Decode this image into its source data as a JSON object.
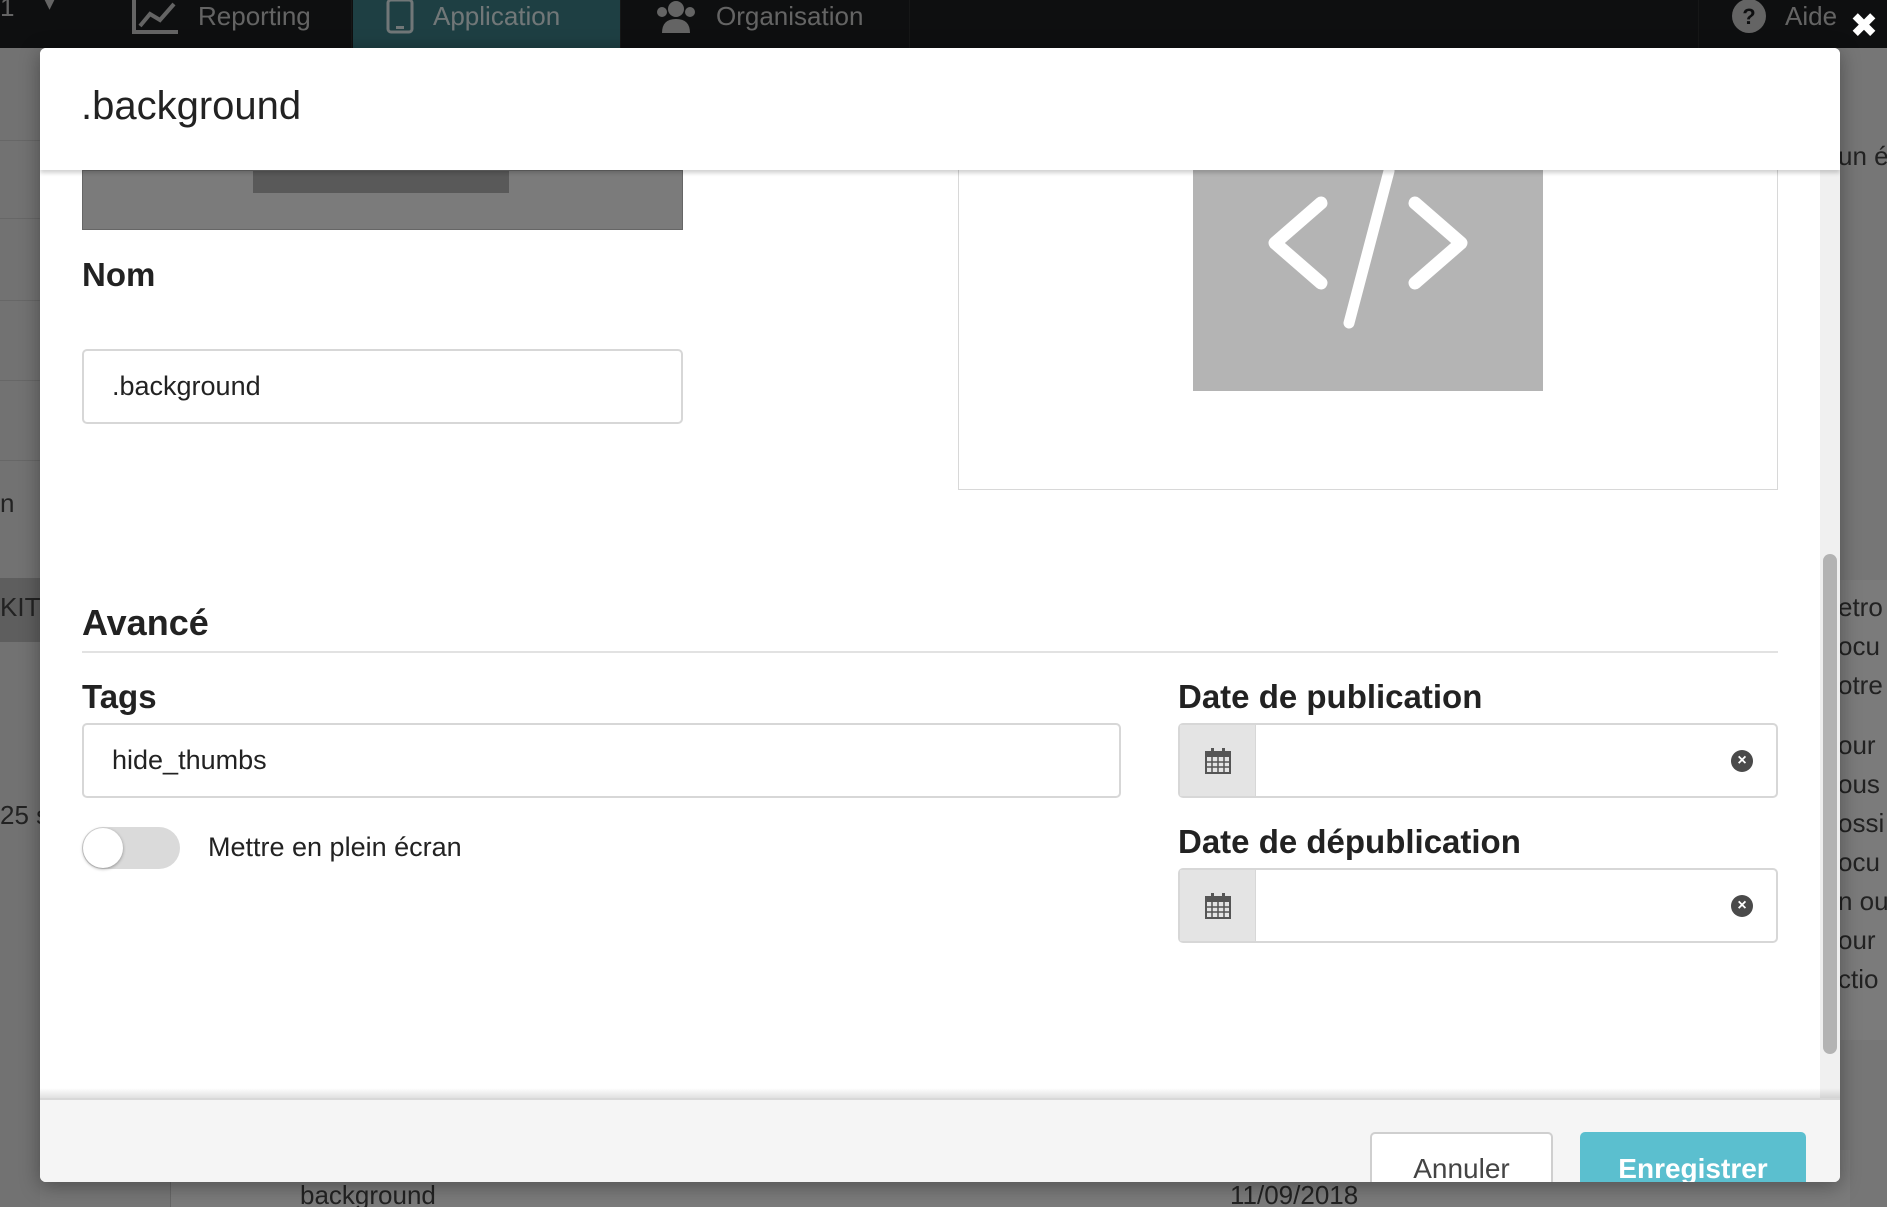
{
  "background": {
    "nav": {
      "left_glyph": "1",
      "caret": "▾",
      "reporting": "Reporting",
      "application": "Application",
      "organisation": "Organisation",
      "aide": "Aide"
    },
    "left_fragments": {
      "n": "n",
      "kit": "KIT",
      "count": "25 s"
    },
    "right_fragments": [
      "un é",
      "etro",
      "ocu",
      "otre",
      "our",
      "ous",
      "ossi",
      "ocu",
      "n ou",
      "our",
      "ctio"
    ],
    "bottom_row": {
      "name": "background",
      "date": "11/09/2018"
    }
  },
  "modal": {
    "title": ".background",
    "close_glyph": "✖",
    "nom": {
      "label": "Nom",
      "value": ".background"
    },
    "preview": {
      "icon": "code-icon"
    },
    "advanced": {
      "title": "Avancé",
      "tags_label": "Tags",
      "tags_value": "hide_thumbs",
      "fullscreen_label": "Mettre en plein écran",
      "fullscreen_on": false,
      "publish_label": "Date de publication",
      "publish_value": "",
      "unpublish_label": "Date de dépublication",
      "unpublish_value": ""
    },
    "footer": {
      "cancel": "Annuler",
      "save": "Enregistrer"
    }
  },
  "colors": {
    "accent": "#5bbfcf",
    "nav_active": "#3c7f86",
    "nav_bg": "#1d1f20"
  }
}
